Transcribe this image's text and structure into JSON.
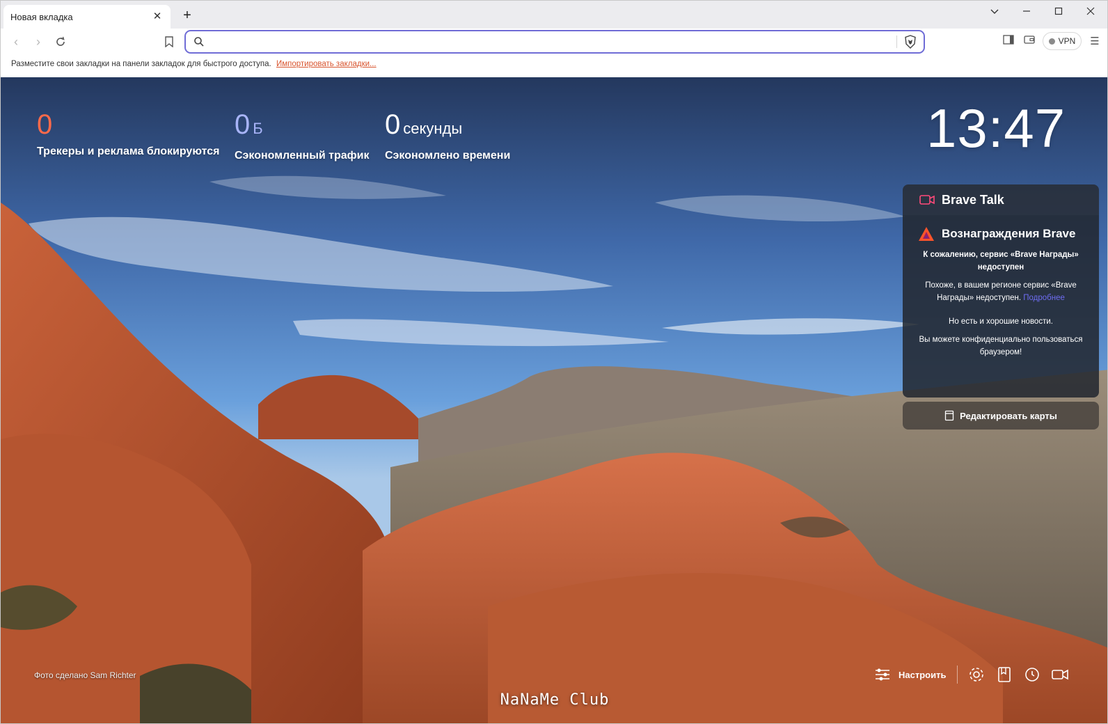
{
  "tab": {
    "title": "Новая вкладка"
  },
  "toolbar": {
    "url": "",
    "vpn_label": "VPN"
  },
  "bookmarks_bar": {
    "hint": "Разместите свои закладки на панели закладок для быстрого доступа.",
    "import_link": "Импортировать закладки..."
  },
  "stats": [
    {
      "value": "0",
      "unit": "",
      "label": "Трекеры и реклама блокируются",
      "color": "#ff6a4a"
    },
    {
      "value": "0",
      "unit": "Б",
      "label": "Сэкономленный трафик",
      "color": "#a8b4f8"
    },
    {
      "value": "0",
      "unit": "секунды",
      "label": "Сэкономлено времени",
      "color": "#ffffff"
    }
  ],
  "clock": {
    "time": "13:47"
  },
  "brave_talk": {
    "title": "Brave Talk"
  },
  "rewards": {
    "title": "Вознаграждения Brave",
    "line1": "К сожалению, сервис «Brave Награды» недоступен",
    "line2": "Похоже, в вашем регионе сервис «Brave Награды» недоступен.",
    "link": "Подробнее",
    "line3": "Но есть и хорошие новости.",
    "line4": "Вы можете конфиденциально пользоваться браузером!"
  },
  "edit_cards": {
    "label": "Редактировать карты"
  },
  "photo_credit": "Фото сделано Sam Richter",
  "customize": {
    "label": "Настроить"
  },
  "watermark": "NaNaMe Club",
  "colors": {
    "accent": "#6f6cd6",
    "link": "#d8542e",
    "brave_orange": "#fb542b"
  }
}
